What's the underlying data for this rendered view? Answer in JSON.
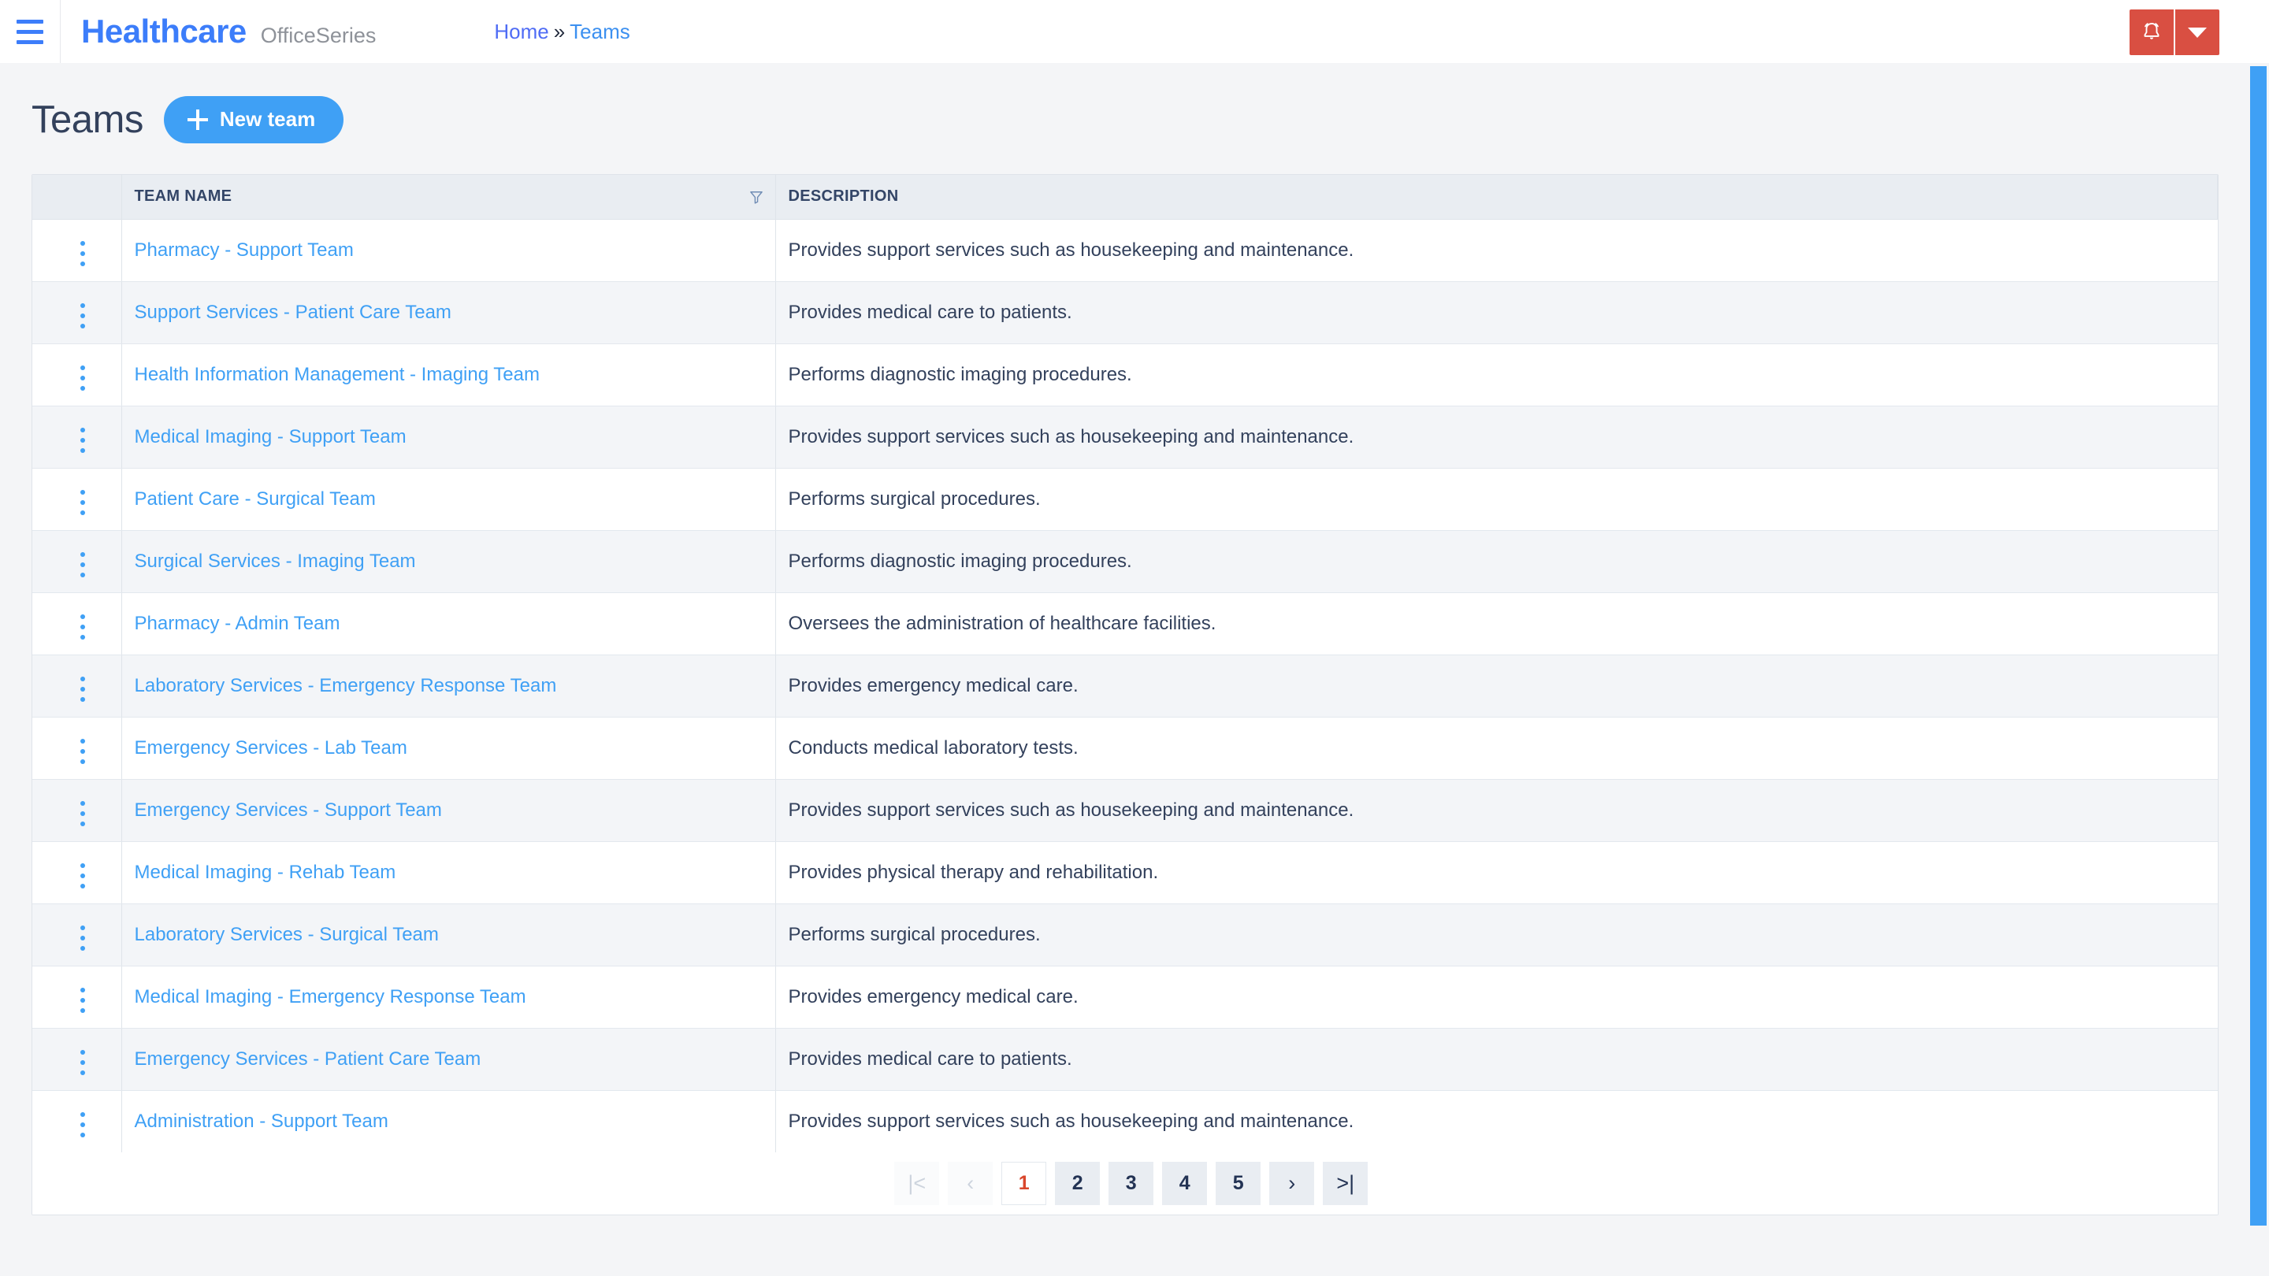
{
  "topbar": {
    "menu_icon": "hamburger-icon",
    "brand_main": "Healthcare",
    "brand_sub": "OfficeSeries",
    "breadcrumb": {
      "home": "Home",
      "separator": "»",
      "current": "Teams"
    },
    "notification_icon": "bell-icon",
    "notification_caret_icon": "chevron-down-icon",
    "notification_color": "#d94f42"
  },
  "page": {
    "title": "Teams",
    "new_button_label": "New team",
    "new_button_icon": "plus-icon",
    "accent_color": "#3fa0f5"
  },
  "table": {
    "columns": [
      "TEAM NAME",
      "DESCRIPTION"
    ],
    "filter_icon": "filter-funnel-icon",
    "row_action_icon": "kebab-menu-icon",
    "rows": [
      {
        "name": "Pharmacy - Support Team",
        "description": "Provides support services such as housekeeping and maintenance."
      },
      {
        "name": "Support Services - Patient Care Team",
        "description": "Provides medical care to patients."
      },
      {
        "name": "Health Information Management - Imaging Team",
        "description": "Performs diagnostic imaging procedures."
      },
      {
        "name": "Medical Imaging - Support Team",
        "description": "Provides support services such as housekeeping and maintenance."
      },
      {
        "name": "Patient Care - Surgical Team",
        "description": "Performs surgical procedures."
      },
      {
        "name": "Surgical Services - Imaging Team",
        "description": "Performs diagnostic imaging procedures."
      },
      {
        "name": "Pharmacy - Admin Team",
        "description": "Oversees the administration of healthcare facilities."
      },
      {
        "name": "Laboratory Services - Emergency Response Team",
        "description": "Provides emergency medical care."
      },
      {
        "name": "Emergency Services - Lab Team",
        "description": "Conducts medical laboratory tests."
      },
      {
        "name": "Emergency Services - Support Team",
        "description": "Provides support services such as housekeeping and maintenance."
      },
      {
        "name": "Medical Imaging - Rehab Team",
        "description": "Provides physical therapy and rehabilitation."
      },
      {
        "name": "Laboratory Services - Surgical Team",
        "description": "Performs surgical procedures."
      },
      {
        "name": "Medical Imaging - Emergency Response Team",
        "description": "Provides emergency medical care."
      },
      {
        "name": "Emergency Services - Patient Care Team",
        "description": "Provides medical care to patients."
      },
      {
        "name": "Administration - Support Team",
        "description": "Provides support services such as housekeeping and maintenance."
      }
    ]
  },
  "pagination": {
    "first_label": "|<",
    "prev_label": "‹",
    "pages": [
      "1",
      "2",
      "3",
      "4",
      "5"
    ],
    "active_page": "1",
    "next_label": "›",
    "last_label": ">|",
    "active_color": "#d9472c"
  }
}
